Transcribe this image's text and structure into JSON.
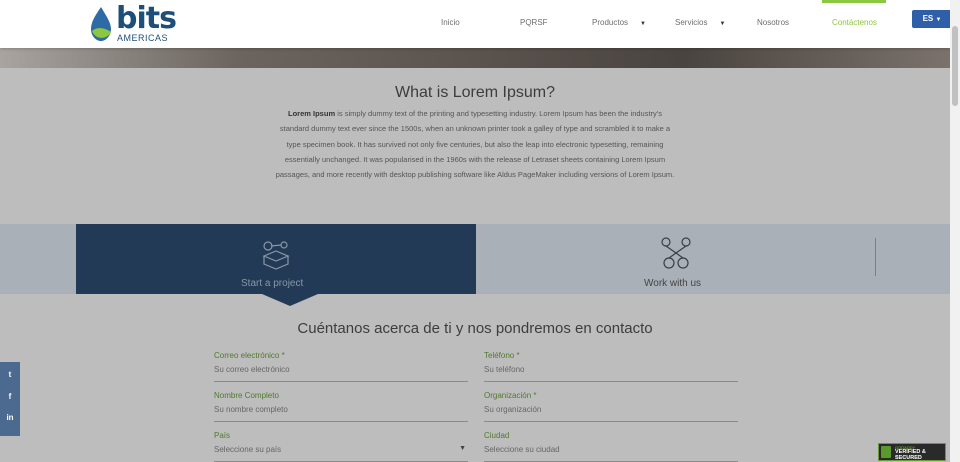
{
  "brand": {
    "word": "bits",
    "sub": "AMERICAS"
  },
  "nav": {
    "items": [
      {
        "label": "Inicio"
      },
      {
        "label": "PQRSF"
      },
      {
        "label": "Productos"
      },
      {
        "label": "Servicios"
      },
      {
        "label": "Nosotros"
      },
      {
        "label": "Contáctenos"
      }
    ],
    "language": "ES"
  },
  "about": {
    "title": "What is Lorem Ipsum?",
    "lead": "Lorem Ipsum",
    "body": " is simply dummy text of the printing and typesetting industry. Lorem Ipsum has been the industry's standard dummy text ever since the 1500s, when an unknown printer took a galley of type and scrambled it to make a type specimen book. It has survived not only five centuries, but also the leap into electronic typesetting, remaining essentially unchanged. It was popularised in the 1960s with the release of Letraset sheets containing Lorem Ipsum passages, and more recently with desktop publishing software like Aldus PageMaker including versions of Lorem Ipsum."
  },
  "tabs": [
    {
      "label": "Start a project",
      "icon": "project-icon",
      "active": true
    },
    {
      "label": "Work with us",
      "icon": "team-icon",
      "active": false
    }
  ],
  "form": {
    "title": "Cuéntanos acerca de ti y nos pondremos en contacto",
    "fields": [
      {
        "label": "Correo electrónico *",
        "placeholder": "Su correo electrónico"
      },
      {
        "label": "Teléfono *",
        "placeholder": "Su teléfono"
      },
      {
        "label": "Nombre Completo",
        "placeholder": "Su nombre completo"
      },
      {
        "label": "Organización *",
        "placeholder": "Su organización"
      },
      {
        "label": "País",
        "placeholder": "Seleccione su país"
      },
      {
        "label": "Ciudad",
        "placeholder": "Seleccione su ciudad"
      }
    ]
  },
  "social": [
    {
      "icon": "twitter-icon",
      "glyph": "t"
    },
    {
      "icon": "facebook-icon",
      "glyph": "f"
    },
    {
      "icon": "linkedin-icon",
      "glyph": "in"
    }
  ],
  "badge": {
    "top": "GODADDY",
    "text": "VERIFIED & SECURED",
    "bottom": "VERIFY SECURITY"
  },
  "colors": {
    "accent": "#8dc63f",
    "primary": "#2f5fa8",
    "dark_panel": "#223a55"
  }
}
